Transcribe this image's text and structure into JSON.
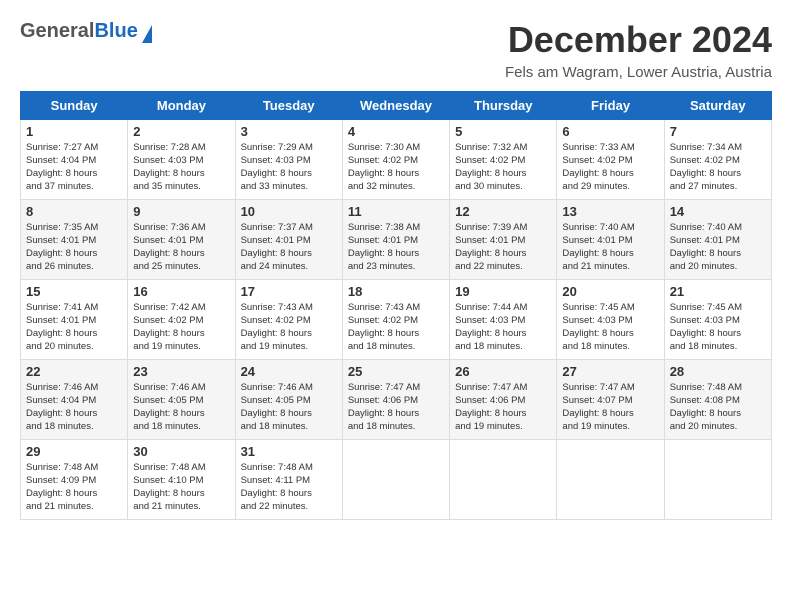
{
  "logo": {
    "general": "General",
    "blue": "Blue"
  },
  "title": {
    "month": "December 2024",
    "location": "Fels am Wagram, Lower Austria, Austria"
  },
  "weekdays": [
    "Sunday",
    "Monday",
    "Tuesday",
    "Wednesday",
    "Thursday",
    "Friday",
    "Saturday"
  ],
  "weeks": [
    [
      {
        "day": "1",
        "info": "Sunrise: 7:27 AM\nSunset: 4:04 PM\nDaylight: 8 hours\nand 37 minutes."
      },
      {
        "day": "2",
        "info": "Sunrise: 7:28 AM\nSunset: 4:03 PM\nDaylight: 8 hours\nand 35 minutes."
      },
      {
        "day": "3",
        "info": "Sunrise: 7:29 AM\nSunset: 4:03 PM\nDaylight: 8 hours\nand 33 minutes."
      },
      {
        "day": "4",
        "info": "Sunrise: 7:30 AM\nSunset: 4:02 PM\nDaylight: 8 hours\nand 32 minutes."
      },
      {
        "day": "5",
        "info": "Sunrise: 7:32 AM\nSunset: 4:02 PM\nDaylight: 8 hours\nand 30 minutes."
      },
      {
        "day": "6",
        "info": "Sunrise: 7:33 AM\nSunset: 4:02 PM\nDaylight: 8 hours\nand 29 minutes."
      },
      {
        "day": "7",
        "info": "Sunrise: 7:34 AM\nSunset: 4:02 PM\nDaylight: 8 hours\nand 27 minutes."
      }
    ],
    [
      {
        "day": "8",
        "info": "Sunrise: 7:35 AM\nSunset: 4:01 PM\nDaylight: 8 hours\nand 26 minutes."
      },
      {
        "day": "9",
        "info": "Sunrise: 7:36 AM\nSunset: 4:01 PM\nDaylight: 8 hours\nand 25 minutes."
      },
      {
        "day": "10",
        "info": "Sunrise: 7:37 AM\nSunset: 4:01 PM\nDaylight: 8 hours\nand 24 minutes."
      },
      {
        "day": "11",
        "info": "Sunrise: 7:38 AM\nSunset: 4:01 PM\nDaylight: 8 hours\nand 23 minutes."
      },
      {
        "day": "12",
        "info": "Sunrise: 7:39 AM\nSunset: 4:01 PM\nDaylight: 8 hours\nand 22 minutes."
      },
      {
        "day": "13",
        "info": "Sunrise: 7:40 AM\nSunset: 4:01 PM\nDaylight: 8 hours\nand 21 minutes."
      },
      {
        "day": "14",
        "info": "Sunrise: 7:40 AM\nSunset: 4:01 PM\nDaylight: 8 hours\nand 20 minutes."
      }
    ],
    [
      {
        "day": "15",
        "info": "Sunrise: 7:41 AM\nSunset: 4:01 PM\nDaylight: 8 hours\nand 20 minutes."
      },
      {
        "day": "16",
        "info": "Sunrise: 7:42 AM\nSunset: 4:02 PM\nDaylight: 8 hours\nand 19 minutes."
      },
      {
        "day": "17",
        "info": "Sunrise: 7:43 AM\nSunset: 4:02 PM\nDaylight: 8 hours\nand 19 minutes."
      },
      {
        "day": "18",
        "info": "Sunrise: 7:43 AM\nSunset: 4:02 PM\nDaylight: 8 hours\nand 18 minutes."
      },
      {
        "day": "19",
        "info": "Sunrise: 7:44 AM\nSunset: 4:03 PM\nDaylight: 8 hours\nand 18 minutes."
      },
      {
        "day": "20",
        "info": "Sunrise: 7:45 AM\nSunset: 4:03 PM\nDaylight: 8 hours\nand 18 minutes."
      },
      {
        "day": "21",
        "info": "Sunrise: 7:45 AM\nSunset: 4:03 PM\nDaylight: 8 hours\nand 18 minutes."
      }
    ],
    [
      {
        "day": "22",
        "info": "Sunrise: 7:46 AM\nSunset: 4:04 PM\nDaylight: 8 hours\nand 18 minutes."
      },
      {
        "day": "23",
        "info": "Sunrise: 7:46 AM\nSunset: 4:05 PM\nDaylight: 8 hours\nand 18 minutes."
      },
      {
        "day": "24",
        "info": "Sunrise: 7:46 AM\nSunset: 4:05 PM\nDaylight: 8 hours\nand 18 minutes."
      },
      {
        "day": "25",
        "info": "Sunrise: 7:47 AM\nSunset: 4:06 PM\nDaylight: 8 hours\nand 18 minutes."
      },
      {
        "day": "26",
        "info": "Sunrise: 7:47 AM\nSunset: 4:06 PM\nDaylight: 8 hours\nand 19 minutes."
      },
      {
        "day": "27",
        "info": "Sunrise: 7:47 AM\nSunset: 4:07 PM\nDaylight: 8 hours\nand 19 minutes."
      },
      {
        "day": "28",
        "info": "Sunrise: 7:48 AM\nSunset: 4:08 PM\nDaylight: 8 hours\nand 20 minutes."
      }
    ],
    [
      {
        "day": "29",
        "info": "Sunrise: 7:48 AM\nSunset: 4:09 PM\nDaylight: 8 hours\nand 21 minutes."
      },
      {
        "day": "30",
        "info": "Sunrise: 7:48 AM\nSunset: 4:10 PM\nDaylight: 8 hours\nand 21 minutes."
      },
      {
        "day": "31",
        "info": "Sunrise: 7:48 AM\nSunset: 4:11 PM\nDaylight: 8 hours\nand 22 minutes."
      },
      {
        "day": "",
        "info": ""
      },
      {
        "day": "",
        "info": ""
      },
      {
        "day": "",
        "info": ""
      },
      {
        "day": "",
        "info": ""
      }
    ]
  ]
}
